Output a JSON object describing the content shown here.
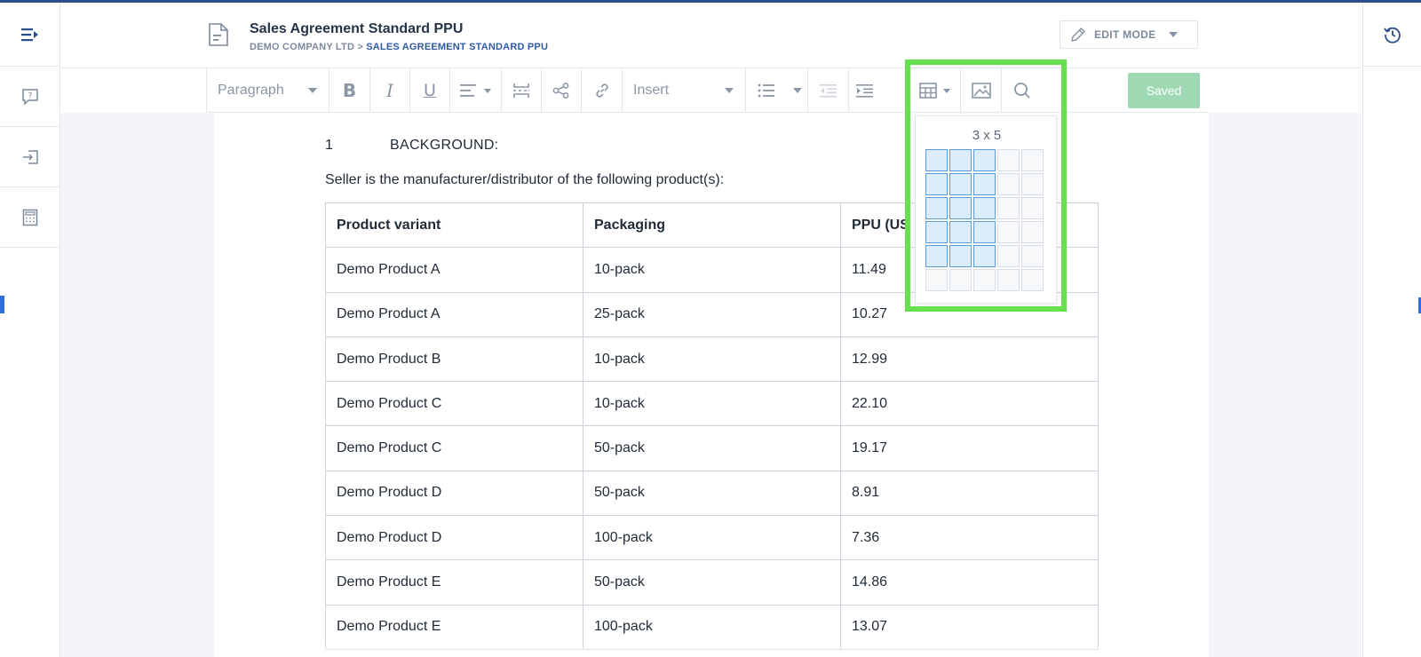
{
  "header": {
    "title": "Sales Agreement Standard PPU",
    "crumb_company": "DEMO COMPANY LTD",
    "crumb_sep": ">",
    "crumb_doc": "SALES AGREEMENT STANDARD PPU",
    "edit_mode_label": "EDIT MODE"
  },
  "toolbar": {
    "paragraph_label": "Paragraph",
    "insert_label": "Insert",
    "saved_label": "Saved"
  },
  "table_picker": {
    "size_label": "3 x 5",
    "selected_cols": 3,
    "selected_rows": 5,
    "total_cols": 5,
    "total_rows": 6
  },
  "document": {
    "section_number": "1",
    "section_title": "BACKGROUND:",
    "intro": "Seller is the manufacturer/distributor of the following product(s):",
    "columns": [
      "Product variant",
      "Packaging",
      "PPU (US"
    ],
    "rows": [
      [
        "Demo Product A",
        "10-pack",
        "11.49"
      ],
      [
        "Demo Product A",
        "25-pack",
        "10.27"
      ],
      [
        "Demo Product B",
        "10-pack",
        "12.99"
      ],
      [
        "Demo Product C",
        "10-pack",
        "22.10"
      ],
      [
        "Demo Product C",
        "50-pack",
        "19.17"
      ],
      [
        "Demo Product D",
        "50-pack",
        "8.91"
      ],
      [
        "Demo Product D",
        "100-pack",
        "7.36"
      ],
      [
        "Demo Product E",
        "50-pack",
        "14.86"
      ],
      [
        "Demo Product E",
        "100-pack",
        "13.07"
      ]
    ]
  },
  "colors": {
    "accent": "#2c4f8a",
    "saved_button": "#9ed9b3",
    "highlight": "#66e04c",
    "grid_selected": "#dbedfb"
  }
}
